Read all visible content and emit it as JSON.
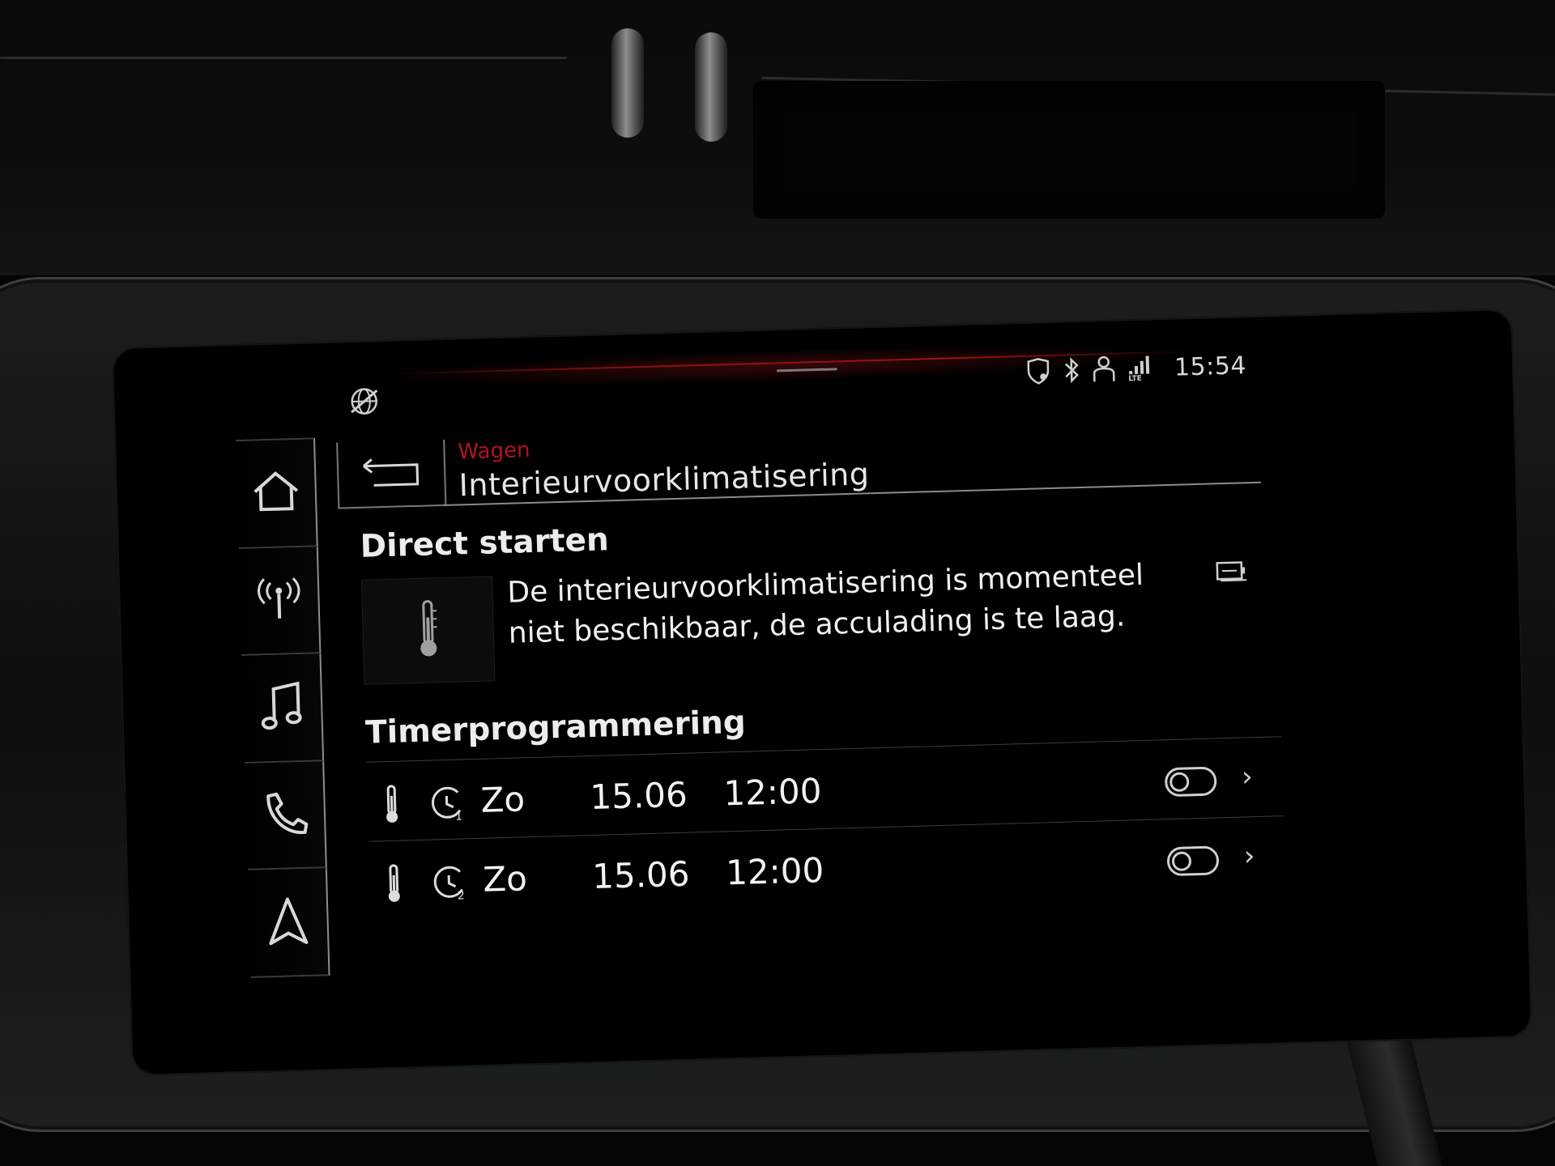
{
  "status_bar": {
    "clock": "15:54",
    "left_icon": "no-connectivity-globe-icon",
    "icons": [
      "location-shield-icon",
      "bluetooth-icon",
      "user-profile-icon",
      "lte-signal-icon"
    ]
  },
  "sidebar": {
    "items": [
      {
        "name": "home",
        "icon": "home-icon"
      },
      {
        "name": "radio",
        "icon": "radio-antenna-icon"
      },
      {
        "name": "media",
        "icon": "music-note-icon"
      },
      {
        "name": "phone",
        "icon": "phone-icon"
      },
      {
        "name": "navigation",
        "icon": "navigation-arrow-icon"
      }
    ]
  },
  "header": {
    "breadcrumb": "Wagen",
    "title": "Interieurvoorklimatisering",
    "back_icon": "back-arrow-icon"
  },
  "direct_start": {
    "title": "Direct starten",
    "tile_icon": "thermometer-icon",
    "message": "De interieurvoorklimatisering is momenteel niet beschikbaar, de acculading is te laag.",
    "status_icon": "battery-charge-icon"
  },
  "timer": {
    "title": "Timerprogrammering",
    "rows": [
      {
        "timer_no": "1",
        "day": "Zo",
        "date": "15.06",
        "time": "12:00",
        "enabled": false
      },
      {
        "timer_no": "2",
        "day": "Zo",
        "date": "15.06",
        "time": "12:00",
        "enabled": false
      }
    ]
  },
  "colors": {
    "accent_red": "#b3141a",
    "text": "#ececec",
    "background": "#000000"
  }
}
